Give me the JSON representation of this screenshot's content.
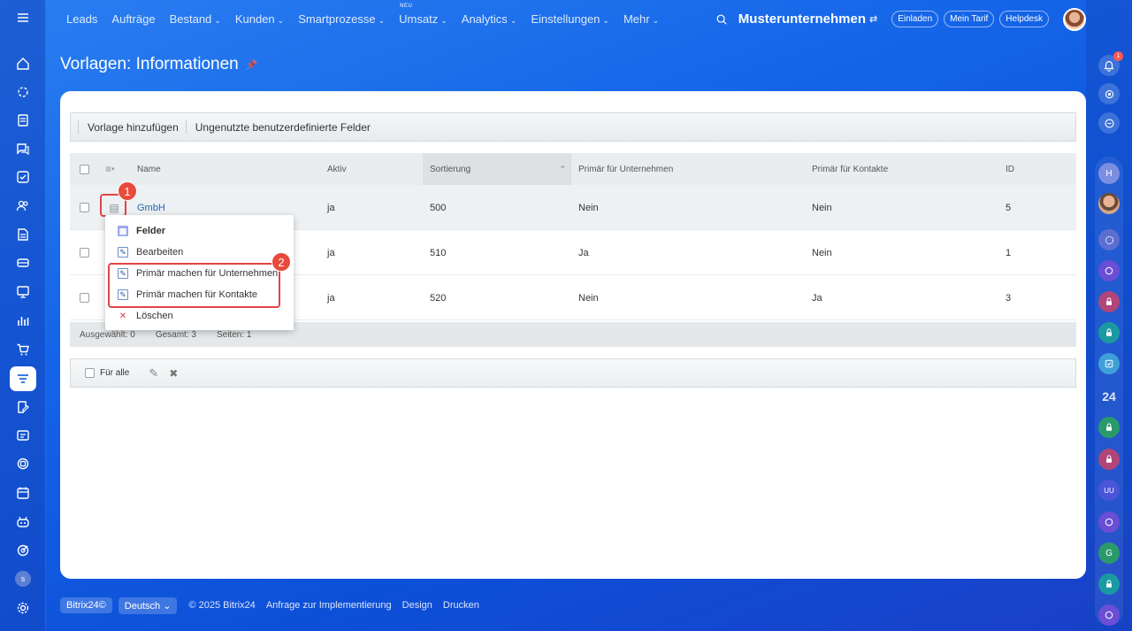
{
  "top_nav": {
    "items": [
      {
        "label": "Leads",
        "caret": false
      },
      {
        "label": "Aufträge",
        "caret": false
      },
      {
        "label": "Bestand",
        "caret": true
      },
      {
        "label": "Kunden",
        "caret": true
      },
      {
        "label": "Smartprozesse",
        "caret": true
      },
      {
        "label": "Umsatz",
        "caret": true,
        "badge": "NEU"
      },
      {
        "label": "Analytics",
        "caret": true
      },
      {
        "label": "Einstellungen",
        "caret": true
      },
      {
        "label": "Mehr",
        "caret": true
      }
    ],
    "company": "Musterunternehmen",
    "invite": "Einladen",
    "tariff": "Mein Tarif",
    "helpdesk": "Helpdesk"
  },
  "page": {
    "title": "Vorlagen: Informationen"
  },
  "toolbar": {
    "add_template": "Vorlage hinzufügen",
    "unused_fields": "Ungenutzte benutzerdefinierte Felder"
  },
  "grid": {
    "columns": [
      "Name",
      "Aktiv",
      "Sortierung",
      "Primär für Unternehmen",
      "Primär für Kontakte",
      "ID"
    ],
    "rows": [
      {
        "name": "GmbH",
        "active": "ja",
        "sort": "500",
        "primary_company": "Nein",
        "primary_contact": "Nein",
        "id": "5"
      },
      {
        "name": "",
        "active": "ja",
        "sort": "510",
        "primary_company": "Ja",
        "primary_contact": "Nein",
        "id": "1"
      },
      {
        "name": "",
        "active": "ja",
        "sort": "520",
        "primary_company": "Nein",
        "primary_contact": "Ja",
        "id": "3"
      }
    ],
    "stats": {
      "selected": "Ausgewählt: 0",
      "total": "Gesamt: 3",
      "pages": "Seiten:  1"
    },
    "action_bar": {
      "for_all": "Für alle"
    }
  },
  "context_menu": {
    "items": [
      {
        "label": "Felder",
        "icon": "fields-icon",
        "bold": true
      },
      {
        "label": "Bearbeiten",
        "icon": "edit-icon"
      },
      {
        "label": "Primär machen für Unternehmen",
        "icon": "edit-icon"
      },
      {
        "label": "Primär machen für Kontakte",
        "icon": "edit-icon"
      },
      {
        "label": "Löschen",
        "icon": "delete-icon"
      }
    ]
  },
  "annotations": {
    "badge_1": "1",
    "badge_2": "2",
    "color": "#e84a3c"
  },
  "right_bar": {
    "notification_count": "1",
    "counter_label": "24"
  },
  "left_bar": {
    "avatar_letter": "s"
  },
  "footer": {
    "brand": "Bitrix24©",
    "language": "Deutsch",
    "copyright": "© 2025 Bitrix24",
    "links": [
      "Anfrage zur Implementierung",
      "Design",
      "Drucken"
    ]
  },
  "colors": {
    "accent": "#1e67e0",
    "link": "#2067b0",
    "highlight": "#e04545"
  }
}
